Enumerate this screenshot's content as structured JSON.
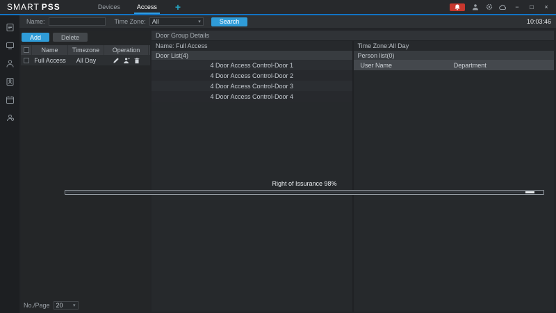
{
  "app": {
    "brand_smart": "SMART",
    "brand_pss": "PSS",
    "tabs": [
      {
        "label": "Devices",
        "active": false
      },
      {
        "label": "Access",
        "active": true
      }
    ],
    "new_tab_label": "+",
    "time": "10:03:46",
    "window_controls": {
      "minimize": "−",
      "maximize": "□",
      "close": "×"
    },
    "colors": {
      "accent_blue": "#1173c4",
      "button_blue": "#2f9cd8",
      "alarm_red": "#c8372d"
    }
  },
  "sidebar": {
    "icons": [
      "nav-log-icon",
      "nav-device-icon",
      "nav-user-icon",
      "nav-permission-icon",
      "nav-attendance-icon",
      "nav-console-icon"
    ]
  },
  "search_bar": {
    "name_label": "Name:",
    "name_value": "",
    "timezone_label": "Time Zone:",
    "timezone_value": "All",
    "search_button": "Search"
  },
  "left_panel": {
    "add_button": "Add",
    "delete_button": "Delete",
    "table": {
      "headers": [
        "Name",
        "Timezone",
        "Operation"
      ],
      "rows": [
        {
          "name": "Full Access",
          "timezone": "All Day"
        }
      ]
    },
    "pagination": {
      "label": "No./Page",
      "value": "20"
    }
  },
  "details": {
    "title": "Door Group Details",
    "name_label": "Name: Full Access",
    "timezone_label": "Time Zone:All Day",
    "door_list_header": "Door  List(4)",
    "doors": [
      "4 Door Access Control-Door 1",
      "4 Door Access Control-Door 2",
      "4 Door Access Control-Door 3",
      "4 Door Access Control-Door 4"
    ],
    "person_list_header": "Person list(0)",
    "person_table_headers": [
      "User Name",
      "Department"
    ]
  },
  "progress": {
    "label": "Right of Issurance 98%",
    "percent": 98
  }
}
